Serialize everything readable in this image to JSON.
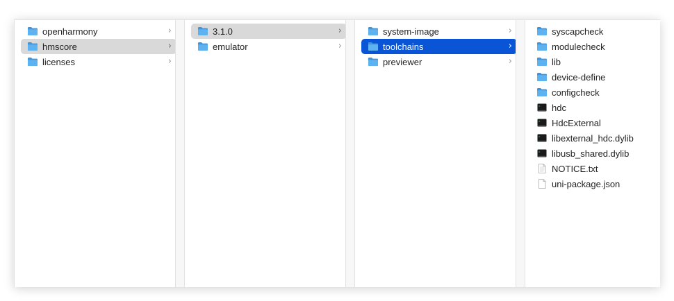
{
  "columns": [
    {
      "items": [
        {
          "label": "openharmony",
          "type": "folder",
          "state": "none",
          "chevron": "›"
        },
        {
          "label": "hmscore",
          "type": "folder",
          "state": "gray",
          "chevron": "›"
        },
        {
          "label": "licenses",
          "type": "folder",
          "state": "none",
          "chevron": "›"
        }
      ]
    },
    {
      "items": [
        {
          "label": "3.1.0",
          "type": "folder",
          "state": "gray",
          "chevron": "›"
        },
        {
          "label": "emulator",
          "type": "folder",
          "state": "none",
          "chevron": "›"
        }
      ]
    },
    {
      "items": [
        {
          "label": "system-image",
          "type": "folder",
          "state": "none",
          "chevron": "›"
        },
        {
          "label": "toolchains",
          "type": "folder",
          "state": "blue",
          "chevron": "›"
        },
        {
          "label": "previewer",
          "type": "folder",
          "state": "none",
          "chevron": "›"
        }
      ]
    },
    {
      "items": [
        {
          "label": "syscapcheck",
          "type": "folder"
        },
        {
          "label": "modulecheck",
          "type": "folder"
        },
        {
          "label": "lib",
          "type": "folder"
        },
        {
          "label": "device-define",
          "type": "folder"
        },
        {
          "label": "configcheck",
          "type": "folder"
        },
        {
          "label": "hdc",
          "type": "exec"
        },
        {
          "label": "HdcExternal",
          "type": "exec"
        },
        {
          "label": "libexternal_hdc.dylib",
          "type": "exec"
        },
        {
          "label": "libusb_shared.dylib",
          "type": "exec"
        },
        {
          "label": "NOTICE.txt",
          "type": "text"
        },
        {
          "label": "uni-package.json",
          "type": "doc"
        }
      ]
    }
  ],
  "icons": {
    "folder": "folder-icon",
    "exec": "executable-icon",
    "text": "text-file-icon",
    "doc": "document-icon",
    "chevron": "chevron-right-icon"
  },
  "colors": {
    "selection_blue": "#0a55d6",
    "selection_gray": "#d9d9d9",
    "folder_blue": "#5fb2f0"
  }
}
